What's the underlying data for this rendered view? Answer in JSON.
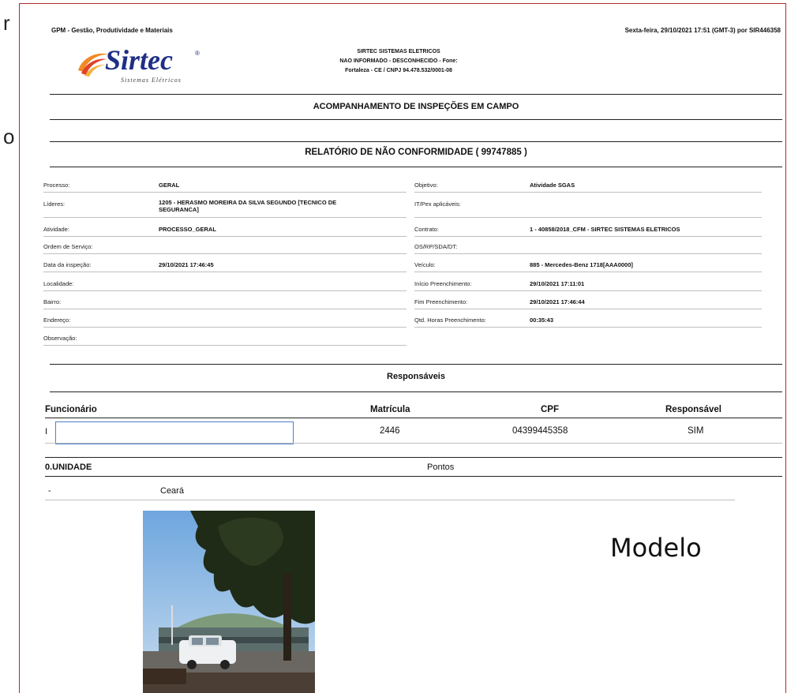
{
  "header": {
    "app_name": "GPM - Gestão, Produtividade e Materiais",
    "timestamp": "Sexta-feira, 29/10/2021 17:51 (GMT-3) por SIR446358"
  },
  "company": {
    "logo_text": "Sirtec",
    "logo_tagline": "Sistemas Elétricos",
    "name": "SIRTEC SISTEMAS ELETRICOS",
    "info": "NAO INFORMADO - DESCONHECIDO - Fone:",
    "location": "Fortaleza - CE / CNPJ 94.478.532/0001-08"
  },
  "report": {
    "section_title": "ACOMPANHAMENTO DE INSPEÇÕES EM CAMPO",
    "title": "RELATÓRIO DE NÃO CONFORMIDADE ( 99747885 )"
  },
  "fields_left": [
    {
      "label": "Processo:",
      "value": "GERAL"
    },
    {
      "label": "Líderes:",
      "value": "1205 - HERASMO MOREIRA DA SILVA SEGUNDO [TECNICO DE",
      "value2": "SEGURANCA]"
    },
    {
      "label": "Atividade:",
      "value": "PROCESSO_GERAL"
    },
    {
      "label": "Ordem de Serviço:",
      "value": ""
    },
    {
      "label": "Data da inspeção:",
      "value": "29/10/2021 17:46:45"
    },
    {
      "label": "Localidade:",
      "value": ""
    },
    {
      "label": "Bairro:",
      "value": ""
    },
    {
      "label": "Endereço:",
      "value": ""
    },
    {
      "label": "Observação:",
      "value": ""
    }
  ],
  "fields_right": [
    {
      "label": "Objetivo:",
      "value": "Atividade SGAS"
    },
    {
      "label": "IT/Pex aplicáveis:",
      "value": ""
    },
    {
      "label": "Contrato:",
      "value": "1 - 40858/2018_CFM - SIRTEC SISTEMAS ELETRICOS"
    },
    {
      "label": "OS/RP/SDA/DT:",
      "value": ""
    },
    {
      "label": "Veículo:",
      "value": "885 - Mercedes-Benz 1718[AAA0000]"
    },
    {
      "label": "Início Preenchimento:",
      "value": "29/10/2021 17:11:01"
    },
    {
      "label": "Fim Preenchimento:",
      "value": "29/10/2021 17:46:44"
    },
    {
      "label": "Qtd. Horas Preenchimento:",
      "value": "00:35:43"
    }
  ],
  "responsaveis": {
    "title": "Responsáveis",
    "headers": [
      "Funcionário",
      "Matrícula",
      "CPF",
      "Responsável"
    ],
    "rows": [
      {
        "funcionario": "",
        "matricula": "2446",
        "cpf": "04399445358",
        "responsavel": "SIM"
      }
    ]
  },
  "unidade": {
    "title": "0.UNIDADE",
    "pontos_label": "Pontos",
    "row_dash": "-",
    "row_value": "Ceará"
  },
  "overlay": {
    "modelo": "Modelo"
  },
  "cut_text": {
    "line1": "r",
    "line2": "o"
  },
  "colors": {
    "frame": "#b22a2a",
    "input_border": "#4a7fcb",
    "logo_blue": "#1f2f86",
    "logo_orange": "#f08a24"
  }
}
